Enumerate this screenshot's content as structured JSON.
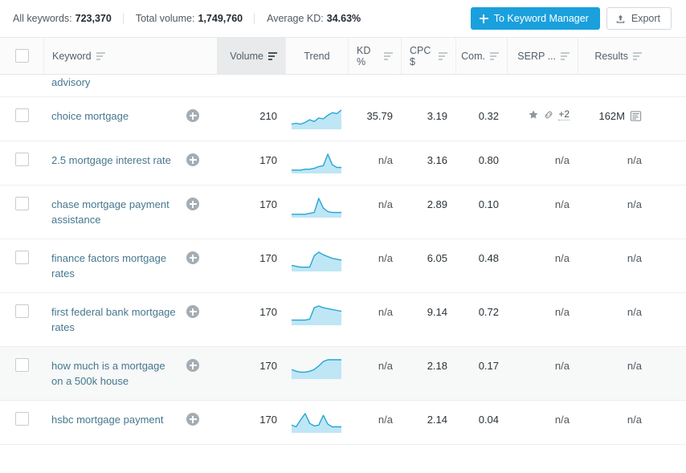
{
  "topbar": {
    "stats": [
      {
        "label": "All keywords:",
        "value": "723,370"
      },
      {
        "label": "Total volume:",
        "value": "1,749,760"
      },
      {
        "label": "Average KD:",
        "value": "34.63%"
      }
    ],
    "primary_button": {
      "label": "To Keyword Manager",
      "icon": "plus-icon",
      "color": "#1aa0dd"
    },
    "secondary_button": {
      "label": "Export",
      "icon": "export-upload-icon"
    }
  },
  "table": {
    "columns": [
      {
        "key": "checkbox",
        "label": "",
        "sortable": false
      },
      {
        "key": "keyword",
        "label": "Keyword",
        "sortable": true,
        "active": false
      },
      {
        "key": "volume",
        "label": "Volume",
        "sortable": true,
        "active": true
      },
      {
        "key": "trend",
        "label": "Trend",
        "sortable": false,
        "active": false
      },
      {
        "key": "kd",
        "label": "KD %",
        "sortable": true,
        "active": false
      },
      {
        "key": "cpc",
        "label": "CPC $",
        "sortable": true,
        "active": false
      },
      {
        "key": "com",
        "label": "Com.",
        "sortable": true,
        "active": false
      },
      {
        "key": "serp",
        "label": "SERP ...",
        "sortable": true,
        "active": false
      },
      {
        "key": "results",
        "label": "Results",
        "sortable": true,
        "active": false
      }
    ],
    "partial_row": {
      "keyword": "advisory"
    },
    "rows": [
      {
        "keyword": "choice mortgage",
        "volume": "210",
        "kd": "35.79",
        "cpc": "3.19",
        "com": "0.32",
        "serp_more": "+2",
        "serp_icons": [
          "star-icon",
          "link-icon"
        ],
        "results": "162M",
        "results_icon": "serp-snapshot-icon",
        "trend": [
          4,
          5,
          4,
          6,
          9,
          7,
          11,
          10,
          14,
          17,
          16,
          20
        ],
        "highlight": false
      },
      {
        "keyword": "2.5 mortgage interest rate",
        "volume": "170",
        "kd": "n/a",
        "cpc": "3.16",
        "com": "0.80",
        "serp_more": null,
        "serp_icons": [],
        "results": "n/a",
        "results_icon": null,
        "trend": [
          2,
          2,
          2,
          3,
          3,
          4,
          6,
          7,
          20,
          8,
          5,
          5
        ],
        "highlight": false
      },
      {
        "keyword": "chase mortgage payment assistance",
        "volume": "170",
        "kd": "n/a",
        "cpc": "2.89",
        "com": "0.10",
        "serp_more": null,
        "serp_icons": [],
        "results": "n/a",
        "results_icon": null,
        "trend": [
          2,
          2,
          2,
          2,
          3,
          4,
          20,
          9,
          5,
          4,
          4,
          4
        ],
        "highlight": false
      },
      {
        "keyword": "finance factors mortgage rates",
        "volume": "170",
        "kd": "n/a",
        "cpc": "6.05",
        "com": "0.48",
        "serp_more": null,
        "serp_icons": [],
        "results": "n/a",
        "results_icon": null,
        "trend": [
          5,
          4,
          3,
          3,
          3,
          16,
          20,
          17,
          15,
          13,
          12,
          11
        ],
        "highlight": false
      },
      {
        "keyword": "first federal bank mortgage rates",
        "volume": "170",
        "kd": "n/a",
        "cpc": "9.14",
        "com": "0.72",
        "serp_more": null,
        "serp_icons": [],
        "results": "n/a",
        "results_icon": null,
        "trend": [
          4,
          4,
          4,
          4,
          5,
          18,
          20,
          18,
          17,
          16,
          15,
          14
        ],
        "highlight": false
      },
      {
        "keyword": "how much is a mortgage on a 500k house",
        "volume": "170",
        "kd": "n/a",
        "cpc": "2.18",
        "com": "0.17",
        "serp_more": null,
        "serp_icons": [],
        "results": "n/a",
        "results_icon": null,
        "trend": [
          9,
          7,
          6,
          6,
          7,
          9,
          13,
          18,
          20,
          20,
          20,
          20
        ],
        "highlight": true
      },
      {
        "keyword": "hsbc mortgage payment",
        "volume": "170",
        "kd": "n/a",
        "cpc": "2.14",
        "com": "0.04",
        "serp_more": null,
        "serp_icons": [],
        "results": "n/a",
        "results_icon": null,
        "trend": [
          7,
          5,
          13,
          20,
          9,
          6,
          7,
          18,
          8,
          5,
          5,
          5
        ],
        "highlight": false
      }
    ]
  },
  "colors": {
    "accent": "#1aa0dd",
    "link": "#46778e",
    "spark_line": "#25a6d6",
    "spark_fill": "#bfe6f5"
  }
}
